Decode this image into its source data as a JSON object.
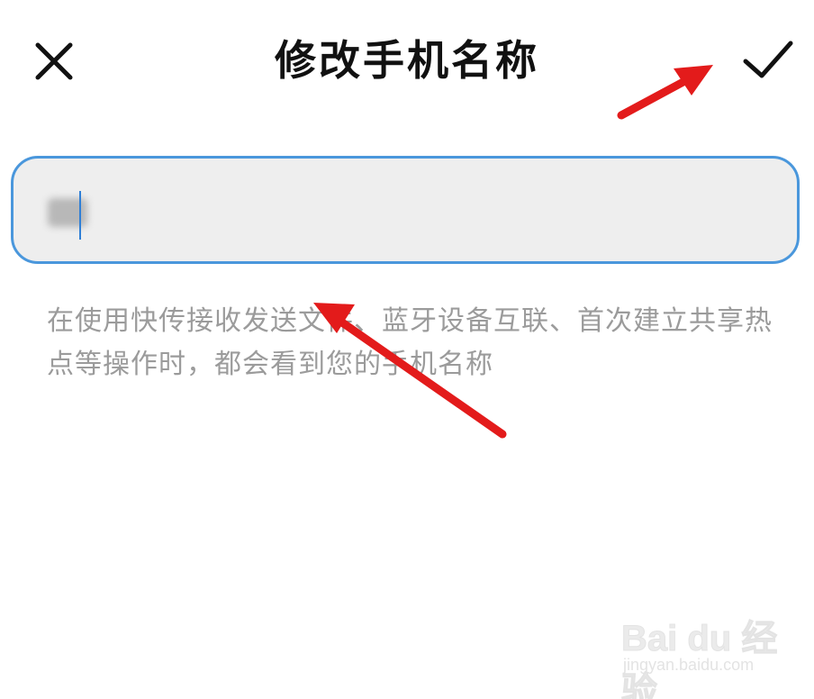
{
  "header": {
    "title": "修改手机名称",
    "close_icon": "close-icon",
    "confirm_icon": "check-icon"
  },
  "name_input": {
    "value": "",
    "value_obscured": true
  },
  "hint_text": "在使用快传接收发送文件、蓝牙设备互联、首次建立共享热点等操作时，都会看到您的手机名称",
  "colors": {
    "input_border": "#4a97dc",
    "input_background": "#eeeeee",
    "hint_text": "#9b9b9b",
    "annotation_arrow": "#e31b1b"
  },
  "watermark": {
    "logo": "Bai du 经验",
    "url": "jingyan.baidu.com"
  }
}
